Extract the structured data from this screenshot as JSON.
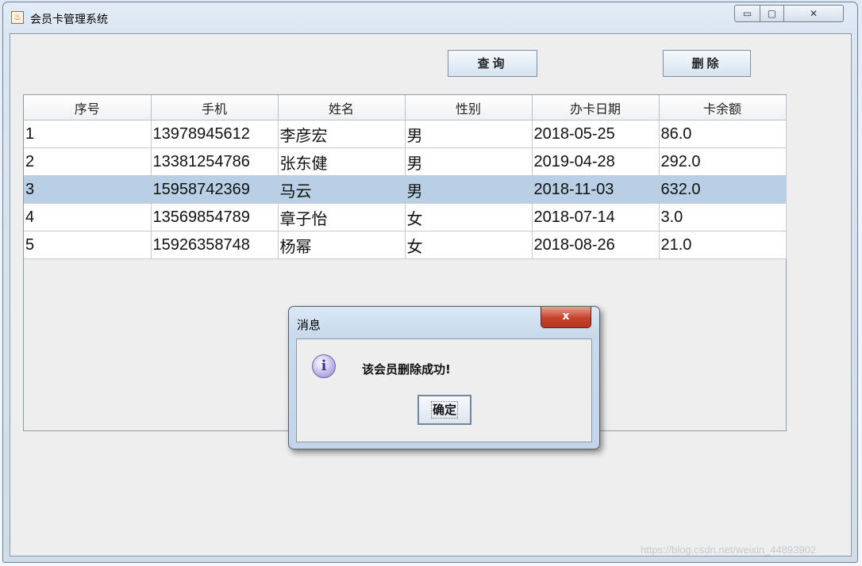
{
  "window": {
    "title": "会员卡管理系统",
    "controls": {
      "minimize": "▭",
      "maximize": "▢",
      "close": "✕"
    }
  },
  "toolbar": {
    "query_label": "查询",
    "delete_label": "删除"
  },
  "table": {
    "columns": [
      "序号",
      "手机",
      "姓名",
      "性别",
      "办卡日期",
      "卡余额"
    ],
    "rows": [
      [
        "1",
        "13978945612",
        "李彦宏",
        "男",
        "2018-05-25",
        "86.0"
      ],
      [
        "2",
        "13381254786",
        "张东健",
        "男",
        "2019-04-28",
        "292.0"
      ],
      [
        "3",
        "15958742369",
        "马云",
        "男",
        "2018-11-03",
        "632.0"
      ],
      [
        "4",
        "13569854789",
        "章子怡",
        "女",
        "2018-07-14",
        "3.0"
      ],
      [
        "5",
        "15926358748",
        "杨幂",
        "女",
        "2018-08-26",
        "21.0"
      ]
    ],
    "selected_row": 3
  },
  "dialog": {
    "title": "消息",
    "close_glyph": "x",
    "info_glyph": "i",
    "message": "该会员删除成功!",
    "ok_label": "确定"
  },
  "watermark": "https://blog.csdn.net/weixin_44893902",
  "colors": {
    "selection": "#b8cfe5",
    "close_button": "#c4412b",
    "info_icon": "#8f86cc"
  }
}
